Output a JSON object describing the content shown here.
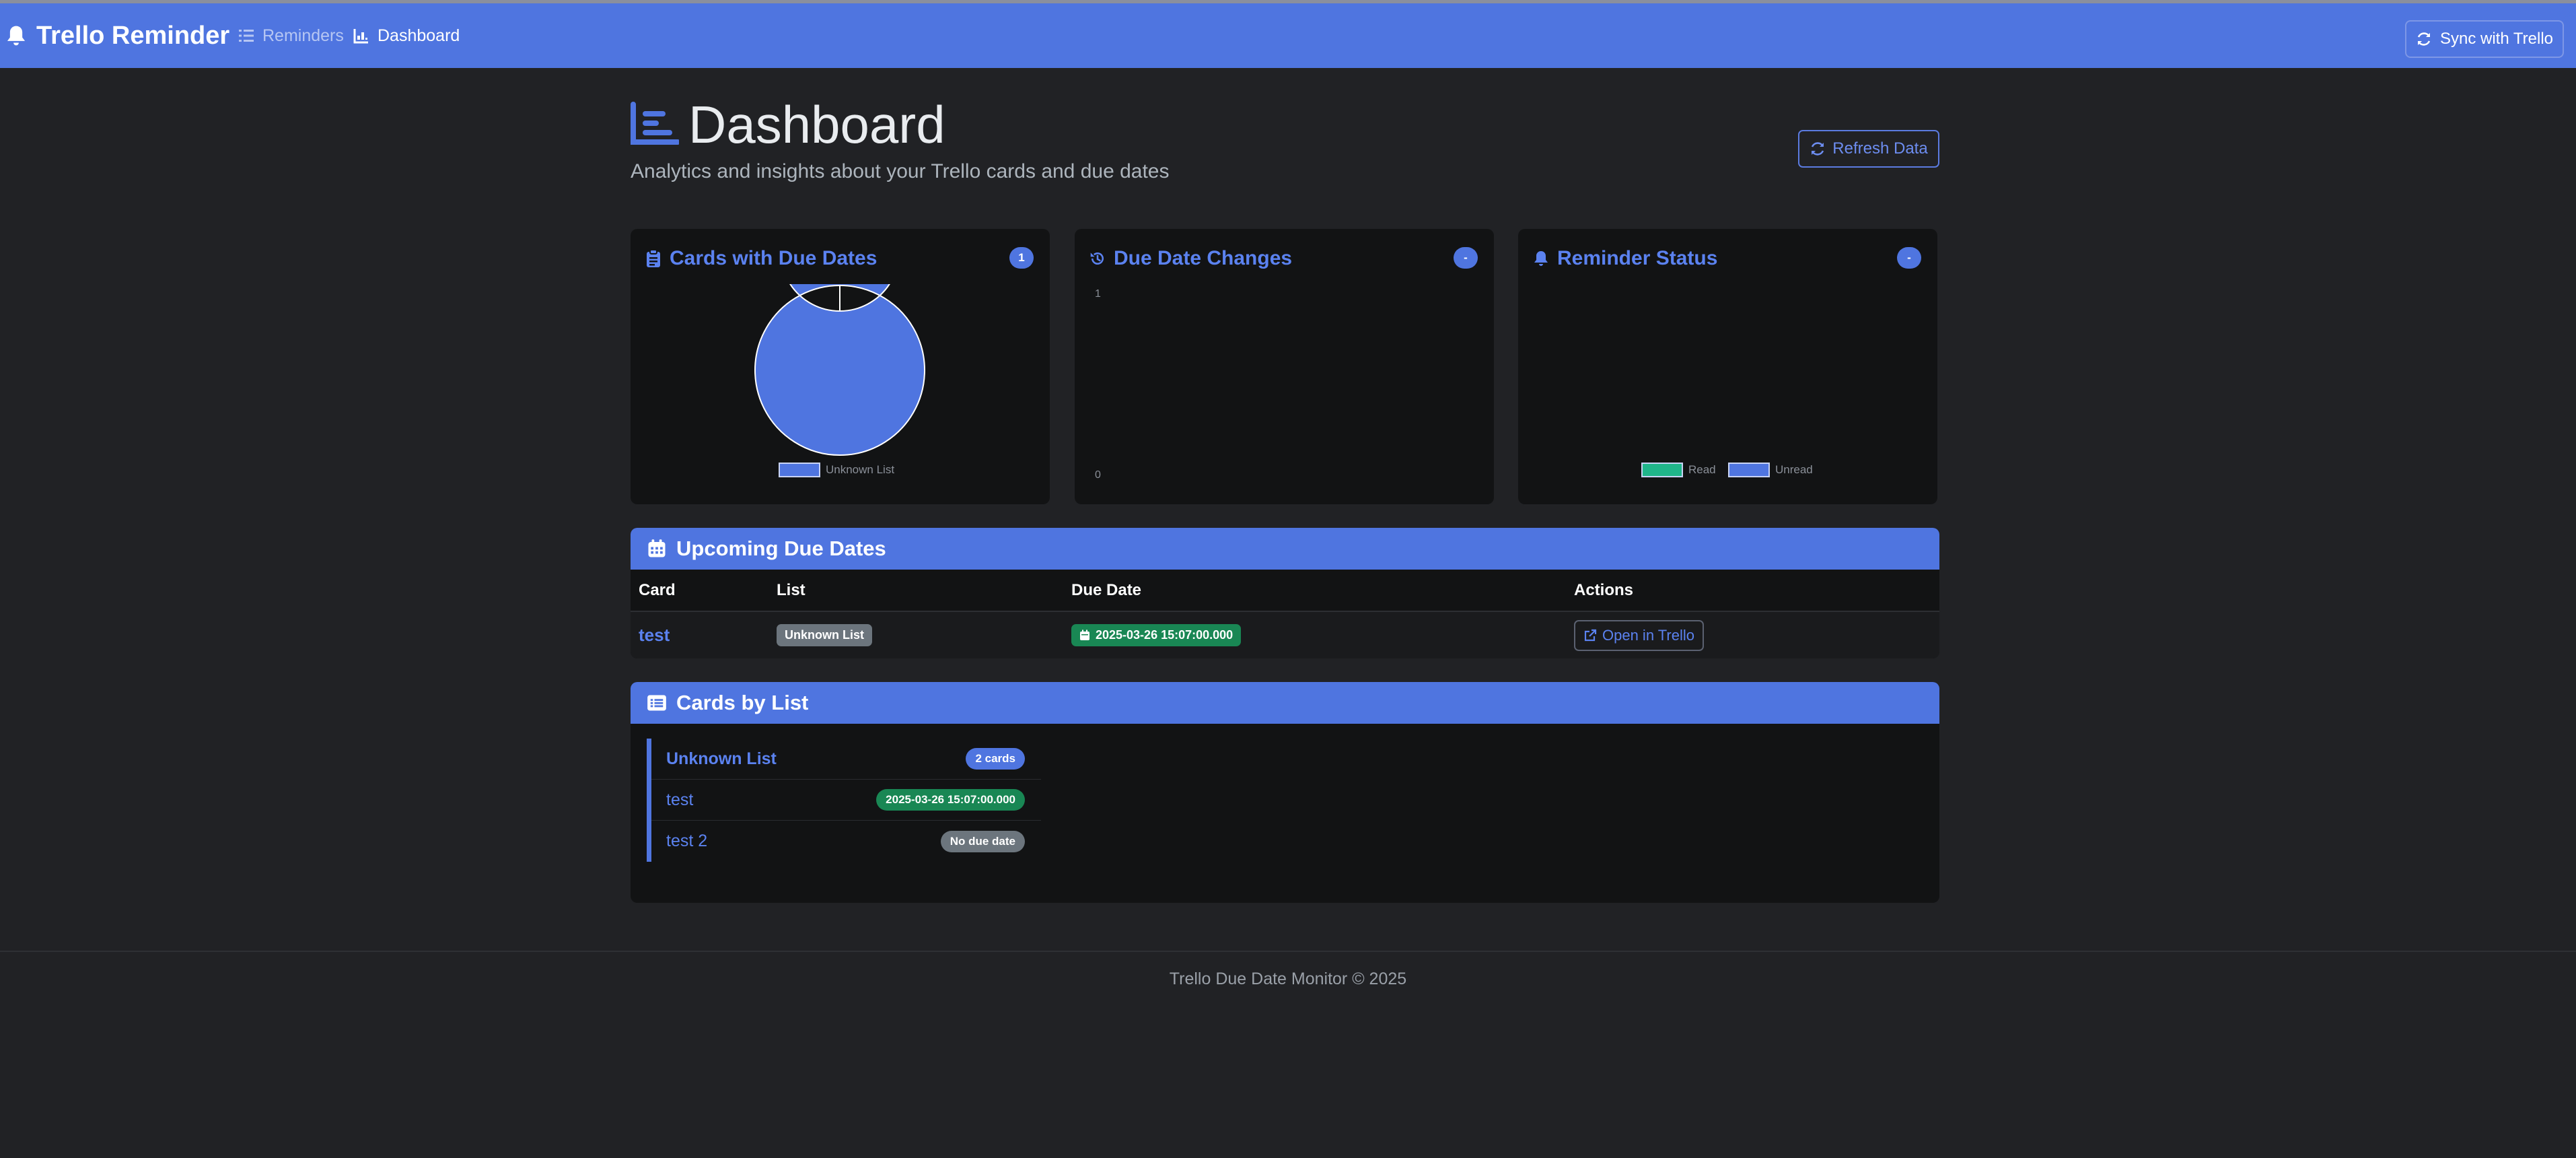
{
  "app": {
    "brand": "Trello Reminder",
    "nav": {
      "reminders": "Reminders",
      "dashboard": "Dashboard"
    },
    "sync_label": "Sync with Trello"
  },
  "header": {
    "title": "Dashboard",
    "subtitle": "Analytics and insights about your Trello cards and due dates",
    "refresh_label": "Refresh Data"
  },
  "cards": [
    {
      "title": "Cards with Due Dates",
      "badge": "1"
    },
    {
      "title": "Due Date Changes",
      "badge": "-"
    },
    {
      "title": "Reminder Status",
      "badge": "-"
    }
  ],
  "chart_data": [
    {
      "type": "pie",
      "categories": [
        "Unknown List"
      ],
      "values": [
        1
      ],
      "legend": [
        "Unknown List"
      ],
      "colors": [
        "#4f75e0"
      ]
    },
    {
      "type": "line",
      "ylim": [
        0,
        1
      ],
      "y_ticks": [
        "1",
        "0"
      ],
      "series": []
    },
    {
      "type": "pie",
      "categories": [
        "Read",
        "Unread"
      ],
      "values": [],
      "legend": [
        "Read",
        "Unread"
      ],
      "colors": [
        "#1fb58a",
        "#4f75e0"
      ]
    }
  ],
  "upcoming": {
    "title": "Upcoming Due Dates",
    "columns": [
      "Card",
      "List",
      "Due Date",
      "Actions"
    ],
    "rows": [
      {
        "card": "test",
        "list": "Unknown List",
        "due": "2025-03-26 15:07:00.000",
        "action": "Open in Trello"
      }
    ]
  },
  "by_list": {
    "title": "Cards by List",
    "group": {
      "name": "Unknown List",
      "count": "2 cards",
      "items": [
        {
          "name": "test",
          "badge": "2025-03-26 15:07:00.000",
          "status": "green"
        },
        {
          "name": "test 2",
          "badge": "No due date",
          "status": "grey"
        }
      ]
    }
  },
  "footer": "Trello Due Date Monitor © 2025",
  "colors": {
    "primary": "#4f75e0",
    "success": "#198754",
    "secondary": "#6c757d",
    "background": "#212225",
    "card": "#121314"
  }
}
